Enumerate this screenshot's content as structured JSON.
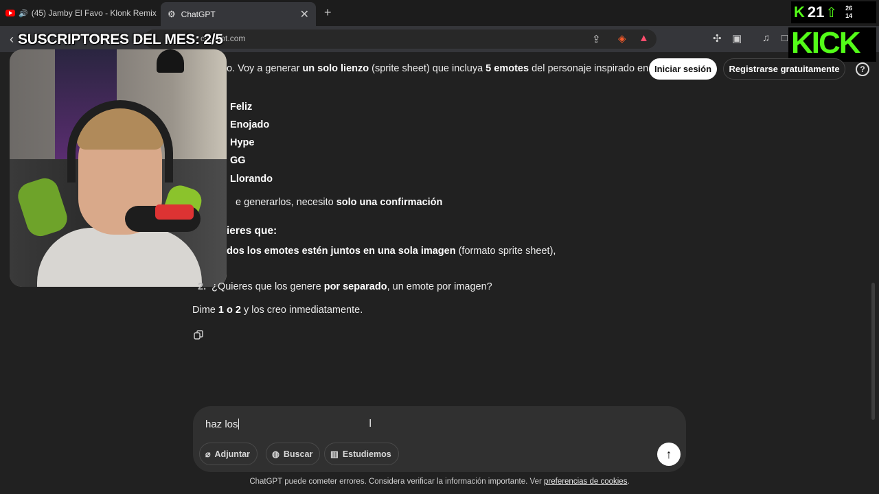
{
  "tabs": [
    {
      "label": "(45) Jamby El Favo - Klonk Remix"
    },
    {
      "label": "ChatGPT"
    }
  ],
  "address": {
    "url": "chatgpt.com"
  },
  "overlay": {
    "subs": "SUSCRIPTORES DEL MES: 2/5",
    "viewers": "21",
    "stat_a": "26",
    "stat_b": "14",
    "kick": "KICK"
  },
  "header": {
    "login": "Iniciar sesión",
    "signup": "Registrarse gratuitamente",
    "help": "?"
  },
  "message": {
    "intro_a": "o. Voy a generar ",
    "intro_b": "un solo lienzo",
    "intro_c": " (sprite sheet) que incluya ",
    "intro_d": "5 emotes",
    "intro_e": " del personaje inspirado en",
    "emotes": [
      "Feliz",
      "Enojado",
      "Hype",
      "GG",
      "Llorando"
    ],
    "before_a": "e generarlos, necesito ",
    "before_b": "solo una confirmación",
    "question": "ieres que:",
    "opt1_a": "dos los emotes estén juntos en una sola imagen",
    "opt1_b": " (formato sprite sheet),",
    "opt2_num": "2.",
    "opt2_a": "¿Quieres que los genere ",
    "opt2_b": "por separado",
    "opt2_c": ", un emote por imagen?",
    "final_a": "Dime ",
    "final_b": "1 o 2",
    "final_c": " y los creo inmediatamente."
  },
  "composer": {
    "text": "haz los",
    "attach": "Adjuntar",
    "search": "Buscar",
    "study": "Estudiemos"
  },
  "footer": {
    "text": "ChatGPT puede cometer errores. Considera verificar la información importante. Ver ",
    "link": "preferencias de cookies",
    "end": "."
  }
}
